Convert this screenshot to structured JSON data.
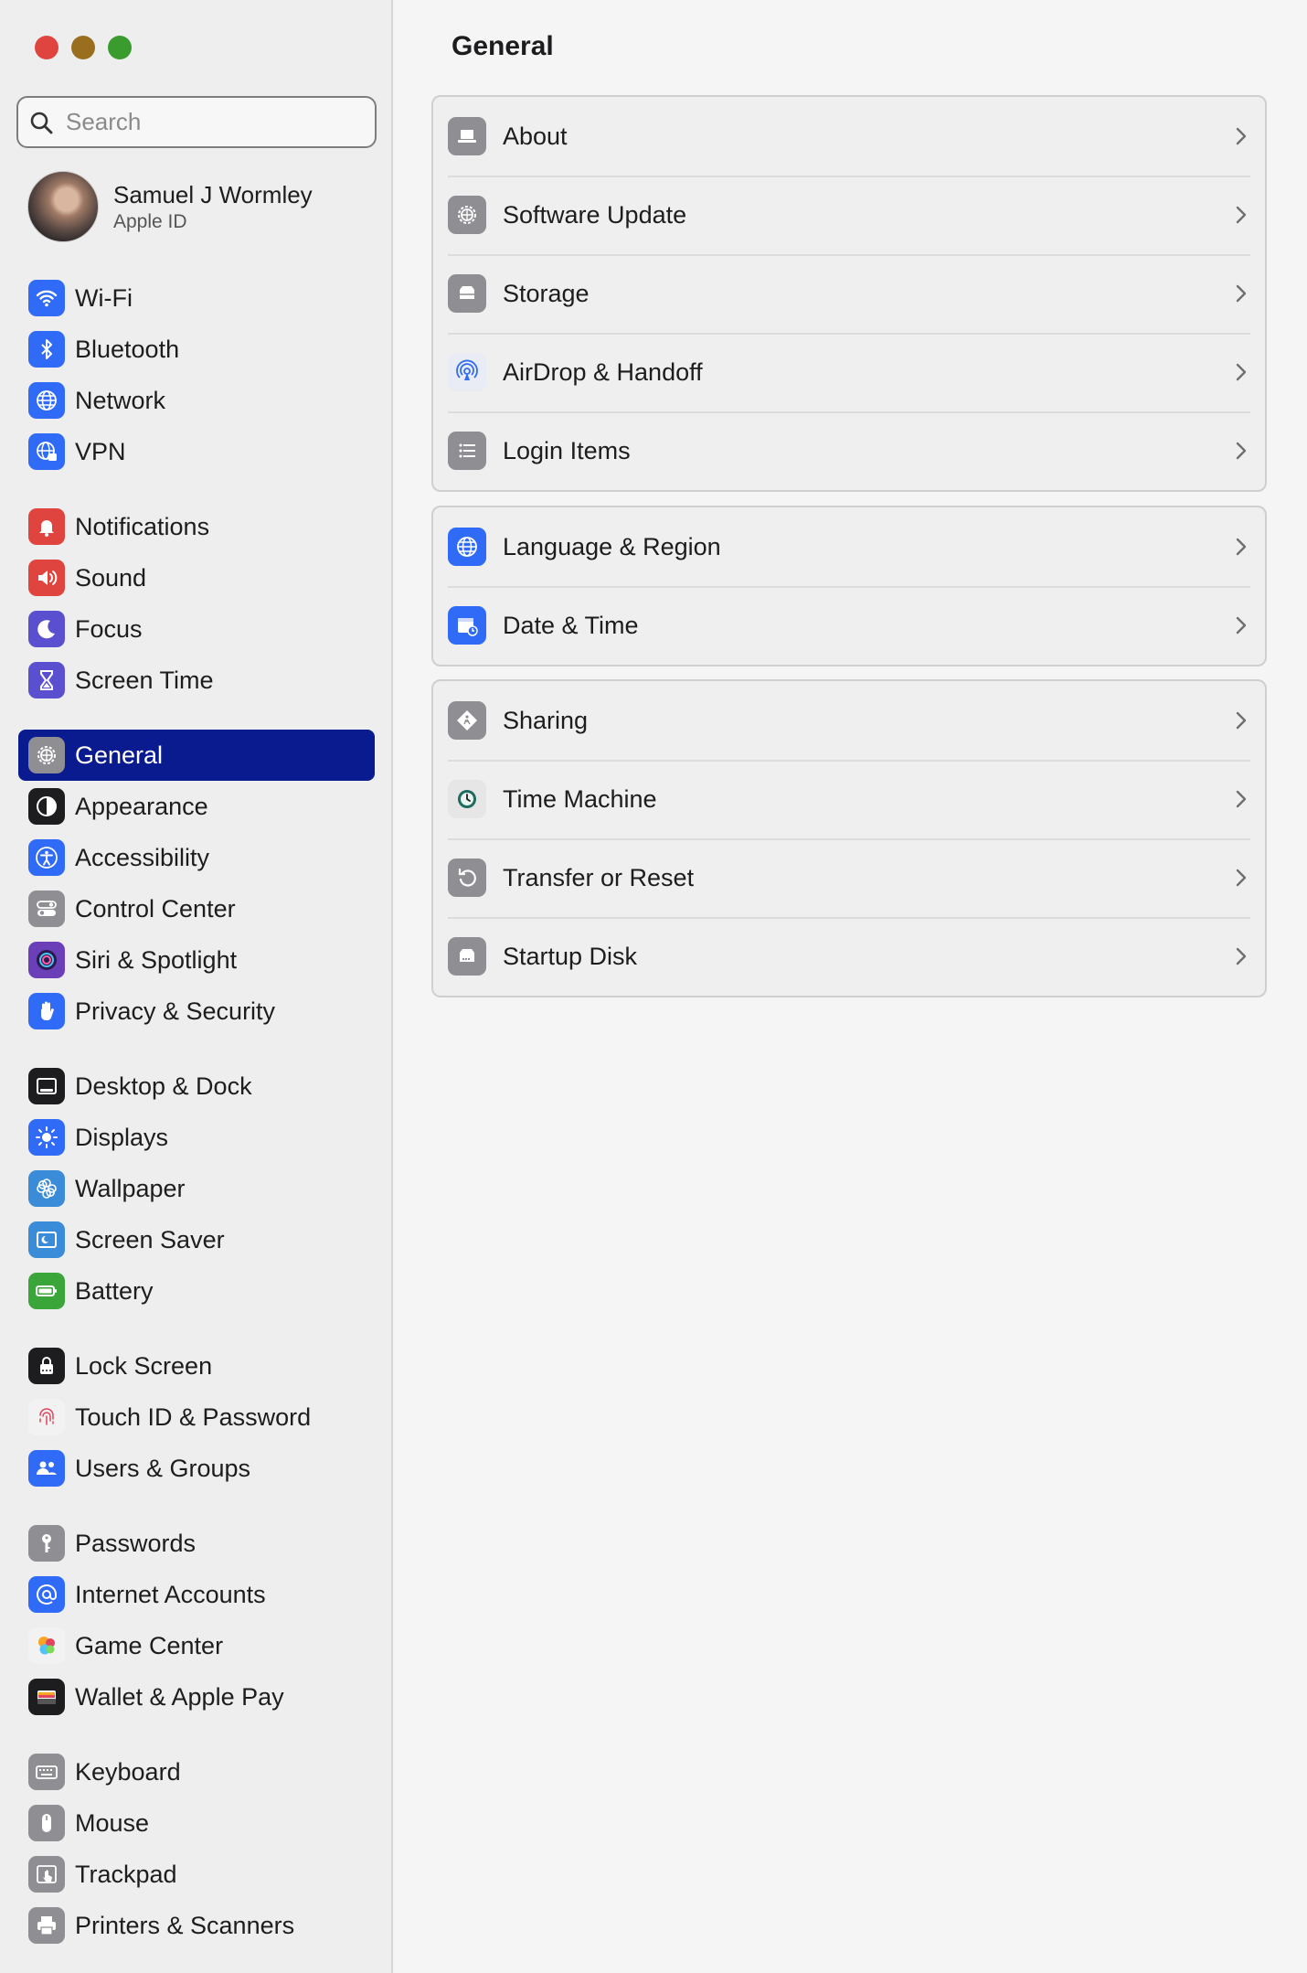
{
  "window": {
    "traffic_lights": [
      {
        "name": "close",
        "color": "#e0443e"
      },
      {
        "name": "minimize",
        "color": "#9a6e1f"
      },
      {
        "name": "zoom",
        "color": "#3a9b2f"
      }
    ]
  },
  "sidebar": {
    "search": {
      "placeholder": "Search",
      "value": ""
    },
    "profile": {
      "name": "Samuel J Wormley",
      "subtitle": "Apple ID"
    },
    "groups": [
      [
        {
          "label": "Wi-Fi",
          "icon": "wifi-icon",
          "color": "#2f6bf6"
        },
        {
          "label": "Bluetooth",
          "icon": "bluetooth-icon",
          "color": "#2f6bf6"
        },
        {
          "label": "Network",
          "icon": "globe-icon",
          "color": "#2f6bf6"
        },
        {
          "label": "VPN",
          "icon": "vpn-globe-icon",
          "color": "#2f6bf6"
        }
      ],
      [
        {
          "label": "Notifications",
          "icon": "bell-icon",
          "color": "#e0443e"
        },
        {
          "label": "Sound",
          "icon": "speaker-icon",
          "color": "#e0443e"
        },
        {
          "label": "Focus",
          "icon": "moon-icon",
          "color": "#5a4fcf"
        },
        {
          "label": "Screen Time",
          "icon": "hourglass-icon",
          "color": "#5a4fcf"
        }
      ],
      [
        {
          "label": "General",
          "icon": "gear-icon",
          "color": "#8e8e93",
          "selected": true
        },
        {
          "label": "Appearance",
          "icon": "appearance-icon",
          "color": "#1d1d1f"
        },
        {
          "label": "Accessibility",
          "icon": "accessibility-icon",
          "color": "#2f6bf6"
        },
        {
          "label": "Control Center",
          "icon": "toggles-icon",
          "color": "#8e8e93"
        },
        {
          "label": "Siri & Spotlight",
          "icon": "siri-icon",
          "color": "#6a3fb8"
        },
        {
          "label": "Privacy & Security",
          "icon": "hand-icon",
          "color": "#2f6bf6"
        }
      ],
      [
        {
          "label": "Desktop & Dock",
          "icon": "dock-icon",
          "color": "#1d1d1f"
        },
        {
          "label": "Displays",
          "icon": "sun-icon",
          "color": "#2f6bf6"
        },
        {
          "label": "Wallpaper",
          "icon": "flower-icon",
          "color": "#3a8bd8"
        },
        {
          "label": "Screen Saver",
          "icon": "screensaver-icon",
          "color": "#3a8bd8"
        },
        {
          "label": "Battery",
          "icon": "battery-icon",
          "color": "#3aa63a"
        }
      ],
      [
        {
          "label": "Lock Screen",
          "icon": "lock-icon",
          "color": "#1d1d1f"
        },
        {
          "label": "Touch ID & Password",
          "icon": "fingerprint-icon",
          "color": "#f2f2f2"
        },
        {
          "label": "Users & Groups",
          "icon": "users-icon",
          "color": "#2f6bf6"
        }
      ],
      [
        {
          "label": "Passwords",
          "icon": "key-icon",
          "color": "#8e8e93"
        },
        {
          "label": "Internet Accounts",
          "icon": "at-icon",
          "color": "#2f6bf6"
        },
        {
          "label": "Game Center",
          "icon": "game-center-icon",
          "color": "#f2f2f2"
        },
        {
          "label": "Wallet & Apple Pay",
          "icon": "wallet-icon",
          "color": "#1d1d1f"
        }
      ],
      [
        {
          "label": "Keyboard",
          "icon": "keyboard-icon",
          "color": "#8e8e93"
        },
        {
          "label": "Mouse",
          "icon": "mouse-icon",
          "color": "#8e8e93"
        },
        {
          "label": "Trackpad",
          "icon": "trackpad-icon",
          "color": "#8e8e93"
        },
        {
          "label": "Printers & Scanners",
          "icon": "printer-icon",
          "color": "#8e8e93"
        }
      ]
    ]
  },
  "main": {
    "title": "General",
    "groups": [
      [
        {
          "label": "About",
          "icon": "laptop-icon",
          "color": "#8e8e93"
        },
        {
          "label": "Software Update",
          "icon": "gear-icon",
          "color": "#8e8e93"
        },
        {
          "label": "Storage",
          "icon": "drive-icon",
          "color": "#8e8e93"
        },
        {
          "label": "AirDrop & Handoff",
          "icon": "airdrop-icon",
          "color": "#e9ecf4"
        },
        {
          "label": "Login Items",
          "icon": "list-icon",
          "color": "#8e8e93"
        }
      ],
      [
        {
          "label": "Language & Region",
          "icon": "globe-icon",
          "color": "#2f6bf6"
        },
        {
          "label": "Date & Time",
          "icon": "calendar-clock-icon",
          "color": "#2f6bf6"
        }
      ],
      [
        {
          "label": "Sharing",
          "icon": "sharing-icon",
          "color": "#8e8e93"
        },
        {
          "label": "Time Machine",
          "icon": "time-machine-icon",
          "color": "#e6e6e6"
        },
        {
          "label": "Transfer or Reset",
          "icon": "reset-icon",
          "color": "#8e8e93"
        },
        {
          "label": "Startup Disk",
          "icon": "disk-icon",
          "color": "#8e8e93"
        }
      ]
    ]
  }
}
